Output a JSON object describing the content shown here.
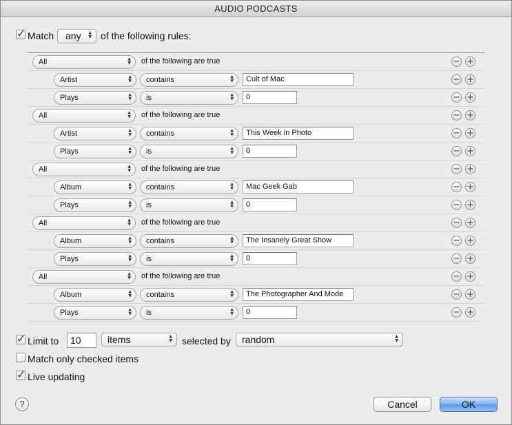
{
  "window": {
    "title": "AUDIO PODCASTS"
  },
  "match": {
    "checked": true,
    "prefix": "Match",
    "mode": "any",
    "suffix": "of the following rules:"
  },
  "groups": [
    {
      "quantifier": "All",
      "text": "of the following are true",
      "rules": [
        {
          "field": "Artist",
          "operator": "contains",
          "value": "Cult of Mac"
        },
        {
          "field": "Plays",
          "operator": "is",
          "value": "0"
        }
      ]
    },
    {
      "quantifier": "All",
      "text": "of the following are true",
      "rules": [
        {
          "field": "Artist",
          "operator": "contains",
          "value": "This Week in Photo"
        },
        {
          "field": "Plays",
          "operator": "is",
          "value": "0"
        }
      ]
    },
    {
      "quantifier": "All",
      "text": "of the following are true",
      "rules": [
        {
          "field": "Album",
          "operator": "contains",
          "value": "Mac Geek Gab"
        },
        {
          "field": "Plays",
          "operator": "is",
          "value": "0"
        }
      ]
    },
    {
      "quantifier": "All",
      "text": "of the following are true",
      "rules": [
        {
          "field": "Album",
          "operator": "contains",
          "value": "The Insanely Great Show"
        },
        {
          "field": "Plays",
          "operator": "is",
          "value": "0"
        }
      ]
    },
    {
      "quantifier": "All",
      "text": "of the following are true",
      "rules": [
        {
          "field": "Album",
          "operator": "contains",
          "value": "The Photographer And Mode"
        },
        {
          "field": "Plays",
          "operator": "is",
          "value": "0"
        }
      ]
    }
  ],
  "limit": {
    "checked": true,
    "label": "Limit to",
    "value": "10",
    "unit": "items",
    "selected_by_label": "selected by",
    "selected_by": "random"
  },
  "options": {
    "match_checked_label": "Match only checked items",
    "match_checked": false,
    "live_updating_label": "Live updating",
    "live_updating": true
  },
  "buttons": {
    "help": "?",
    "cancel": "Cancel",
    "ok": "OK"
  },
  "icons": {
    "remove": "minus-circle-icon",
    "add": "plus-circle-icon",
    "popup": "up-down-arrows-icon"
  },
  "colors": {
    "accent": "#5c9be6",
    "check": "#1f3c8f"
  }
}
